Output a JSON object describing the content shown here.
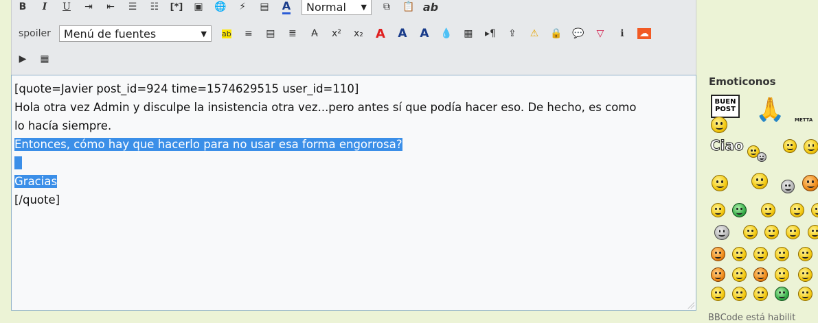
{
  "toolbar": {
    "row1": [
      {
        "name": "bold-button",
        "glyph": "B",
        "style": "bold"
      },
      {
        "name": "italic-button",
        "glyph": "I",
        "style": "italic"
      },
      {
        "name": "underline-button",
        "glyph": "U",
        "style": "underline"
      },
      {
        "name": "indent-icon",
        "glyph": "⇥"
      },
      {
        "name": "outdent-icon",
        "glyph": "⇤"
      },
      {
        "name": "bullet-list-button",
        "glyph": "☰"
      },
      {
        "name": "numbered-list-button",
        "glyph": "☷"
      },
      {
        "name": "list-item-button",
        "glyph": "[*]"
      },
      {
        "name": "image-button",
        "glyph": "▣"
      },
      {
        "name": "link-button",
        "glyph": "🌐"
      },
      {
        "name": "flash-button",
        "glyph": "⚡"
      },
      {
        "name": "video-button",
        "glyph": "▤"
      },
      {
        "name": "font-color-button",
        "glyph": "A"
      }
    ],
    "size_select": "Normal",
    "row1_after": [
      {
        "name": "copy-button",
        "glyph": "⧉"
      },
      {
        "name": "paste-button",
        "glyph": "📋"
      },
      {
        "name": "ab-button",
        "glyph": "ab"
      }
    ],
    "spoiler_label": "spoiler",
    "font_select": "Menú de fuentes",
    "row2": [
      {
        "name": "highlight-button",
        "glyph": "ab"
      },
      {
        "name": "align-center-button",
        "glyph": "≡"
      },
      {
        "name": "align-justify-button",
        "glyph": "▤"
      },
      {
        "name": "align-right-button",
        "glyph": "≣"
      },
      {
        "name": "strikethrough-button",
        "glyph": "A̶"
      },
      {
        "name": "superscript-button",
        "glyph": "x²"
      },
      {
        "name": "subscript-button",
        "glyph": "x₂"
      },
      {
        "name": "outline-text-button",
        "glyph": "A"
      },
      {
        "name": "shadow-text-button",
        "glyph": "A"
      },
      {
        "name": "glow-text-button",
        "glyph": "A"
      },
      {
        "name": "fade-button",
        "glyph": "💧"
      },
      {
        "name": "gradient-button",
        "glyph": "▦"
      },
      {
        "name": "direction-button",
        "glyph": "▸¶"
      },
      {
        "name": "upload-button",
        "glyph": "⇪"
      },
      {
        "name": "warning-button",
        "glyph": "⚠"
      },
      {
        "name": "lock-button",
        "glyph": "🔒"
      },
      {
        "name": "speech-button",
        "glyph": "💬"
      },
      {
        "name": "alert-button",
        "glyph": "▽"
      },
      {
        "name": "info-button",
        "glyph": "ℹ"
      },
      {
        "name": "soundcloud-button",
        "glyph": "☁"
      }
    ],
    "row3": [
      {
        "name": "play-button",
        "glyph": "▶"
      },
      {
        "name": "table-button",
        "glyph": "▦"
      }
    ]
  },
  "editor": {
    "lines": [
      {
        "text": "[quote=Javier post_id=924 time=1574629515 user_id=110]",
        "selected": false
      },
      {
        "text": "Hola otra vez Admin y disculpe la insistencia otra vez...pero antes sí que podía hacer eso. De hecho, es como",
        "selected": false
      },
      {
        "text": "lo hacía siempre.",
        "selected": false
      },
      {
        "text": "Entonces, cómo hay que hacerlo para no usar esa forma engorrosa?",
        "selected": true
      },
      {
        "text": "  ",
        "selected": true
      },
      {
        "text": "Gracias",
        "selected": true
      },
      {
        "text": "[/quote]",
        "selected": false
      }
    ]
  },
  "sidebar": {
    "title": "Emoticonos",
    "post_sign": "BUEN POST",
    "ciao_label": "Ciao",
    "metta_label": "METTA",
    "bottom_text": "BBCode está habilit"
  },
  "colors": {
    "page_bg": "#ecf3d6",
    "toolbar_bg": "#e7e9eb",
    "selection": "#3b8fe8",
    "textarea_border": "#8fb0c8"
  }
}
